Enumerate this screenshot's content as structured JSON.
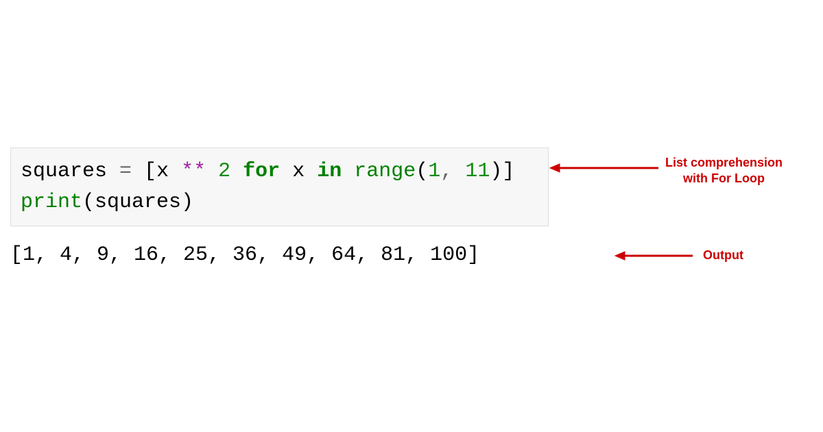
{
  "code": {
    "line1": {
      "var": "squares",
      "eq": " = ",
      "lb": "[",
      "x1": "x",
      "sp1": " ",
      "pow": "**",
      "sp2": " ",
      "two": "2",
      "sp3": " ",
      "for_kw": "for",
      "sp4": " ",
      "x2": "x",
      "sp5": " ",
      "in_kw": "in",
      "sp6": " ",
      "range": "range",
      "paren_open": "(",
      "one": "1",
      "comma": ", ",
      "eleven": "11",
      "paren_close": ")",
      "rb": "]"
    },
    "line2": {
      "print": "print",
      "paren_open": "(",
      "arg": "squares",
      "paren_close": ")"
    }
  },
  "output": "[1, 4, 9, 16, 25, 36, 49, 64, 81, 100]",
  "annotations": {
    "top_line1": "List comprehension",
    "top_line2": "with For Loop",
    "bottom": "Output"
  }
}
